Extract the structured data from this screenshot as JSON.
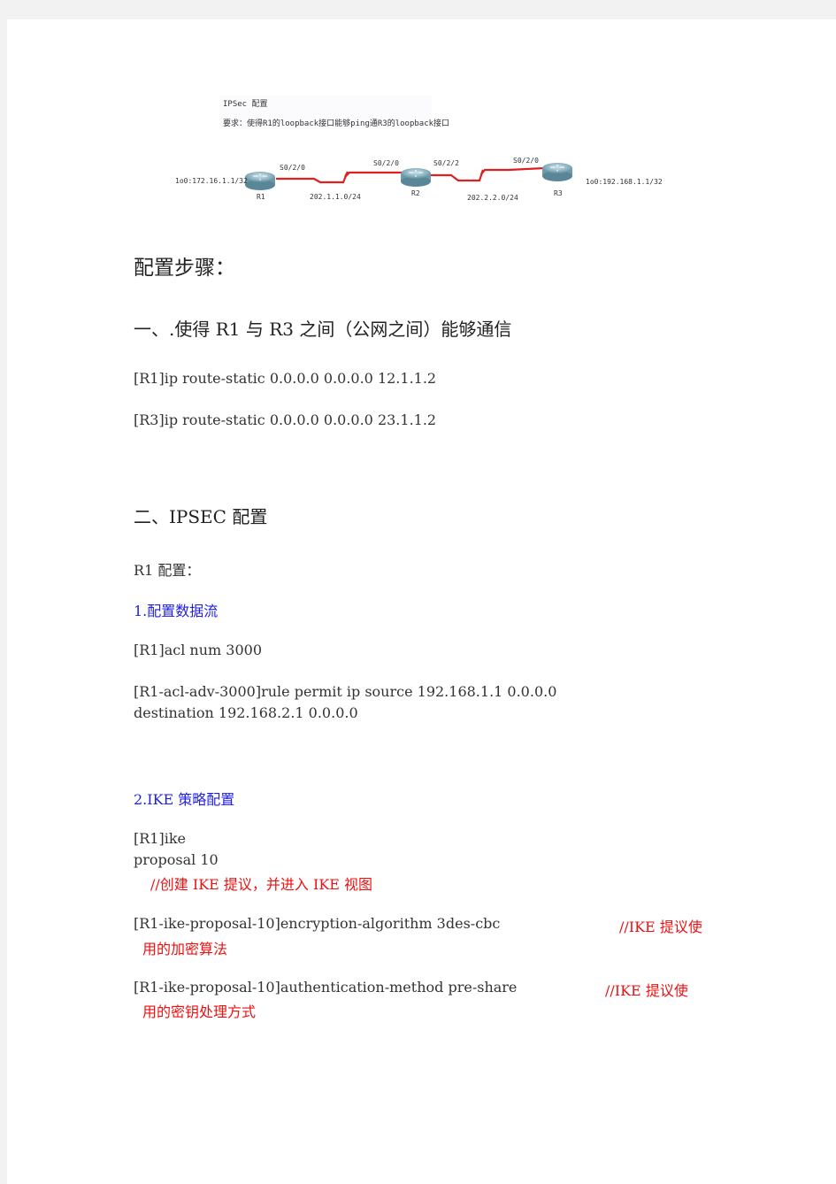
{
  "diagram": {
    "title": "IPSec 配置",
    "requirement": "要求：使得R1的loopback接口能够ping通R3的loopback接口",
    "routers": [
      {
        "name": "R1",
        "loopback": "1o0:172.16.1.1/32"
      },
      {
        "name": "R2"
      },
      {
        "name": "R3",
        "loopback": "1o0:192.168.1.1/32"
      }
    ],
    "interfaces": {
      "r1_s": "S0/2/0",
      "r2_left": "S0/2/0",
      "r2_right": "S0/2/2",
      "r3_s": "S0/2/0"
    },
    "networks": [
      "202.1.1.0/24",
      "202.2.2.0/24"
    ],
    "link_color": "#e02020"
  },
  "doc": {
    "heading": "配置步骤：",
    "section1": {
      "title": "一、.使得 R1 与 R3 之间（公网之间）能够通信",
      "lines": [
        "[R1]ip route-static 0.0.0.0 0.0.0.0 12.1.1.2",
        "[R3]ip route-static 0.0.0.0 0.0.0.0 23.1.1.2"
      ]
    },
    "section2": {
      "title": "二、IPSEC 配置",
      "r1_label": "R1 配置：",
      "step1": {
        "title": "1.配置数据流",
        "lines": [
          "[R1]acl   num 3000",
          "[R1-acl-adv-3000]rule   permit   ip source   192.168.1.1 0.0.0.0",
          "destination 192.168.2.1 0.0.0.0"
        ]
      },
      "step2": {
        "title": "2.IKE 策略配置",
        "line1": "[R1]ike",
        "line2": "proposal   10",
        "comment1": "//创建 IKE 提议，并进入 IKE 视图",
        "cmd2": "[R1-ike-proposal-10]encryption-algorithm 3des-cbc",
        "comment2a": "//IKE 提议使",
        "comment2b": "用的加密算法",
        "cmd3": "[R1-ike-proposal-10]authentication-method   pre-share",
        "comment3a": "//IKE 提议使",
        "comment3b": "用的密钥处理方式"
      }
    }
  },
  "colors": {
    "heading_blue": "#1f1fe0",
    "comment_red": "#ee1111"
  }
}
